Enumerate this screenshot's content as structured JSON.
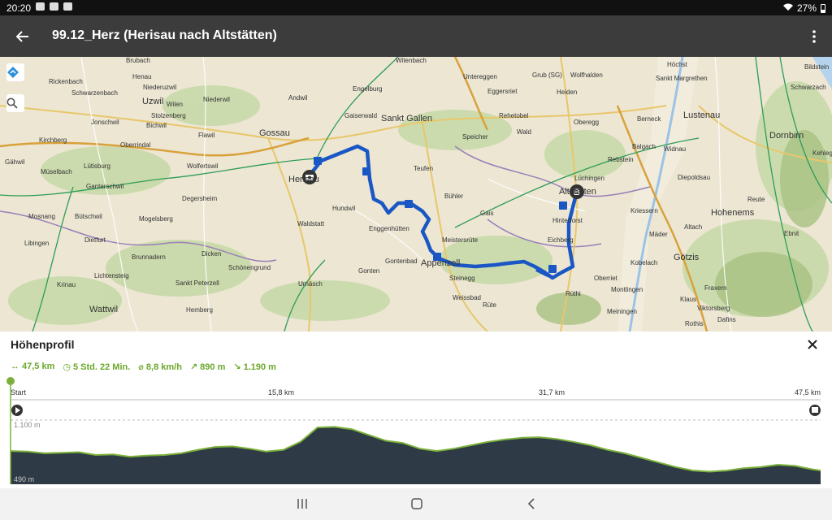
{
  "status_bar": {
    "time": "20:20",
    "battery": "27%"
  },
  "app_bar": {
    "title": "99.12_Herz (Herisau nach Altstätten)",
    "back_icon": "arrow-left-icon",
    "menu_icon": "more-vert-icon"
  },
  "map": {
    "labels": [
      "Brubach",
      "Rickenbach",
      "Schwarzenbach",
      "Uzwil",
      "Henau",
      "Niederuzwil",
      "Wilen",
      "Stolzenberg",
      "Jonschwil",
      "Bichwil",
      "Niederwil",
      "Flawil",
      "Kirchberg",
      "Oberrindal",
      "Gähwil",
      "Lütisburg",
      "Müselbach",
      "Wolfertswil",
      "Ganterschwil",
      "Degersheim",
      "Mosnang",
      "Bütschwil",
      "Mogelsberg",
      "Dietfurt",
      "Brunnadern",
      "Dicken",
      "Libingen",
      "Schönengrund",
      "Krinau",
      "Lichtensteig",
      "Sankt Peterzell",
      "Urnäsch",
      "Hemberg",
      "Wattwil",
      "Gossau",
      "Andwil",
      "Witenbach",
      "Engelburg",
      "Gaiserwald",
      "Sankt Gallen",
      "Teufen",
      "Herisau",
      "Waldstatt",
      "Hundwil",
      "Enggenhütten",
      "Bühler",
      "Speicher",
      "Gais",
      "Meistersrüte",
      "Gontenbad",
      "Gonten",
      "Appenzell",
      "Steinegg",
      "Weissbad",
      "Rüte",
      "Untereggen",
      "Eggersriet",
      "Rehetobel",
      "Wald",
      "Grub (SG)",
      "Wolfhalden",
      "Heiden",
      "Oberegg",
      "Berneck",
      "Balgach",
      "Rebstein",
      "Widnau",
      "Lüchingen",
      "Altstätten",
      "Hinterforst",
      "Eichberg",
      "Kriessern",
      "Diepoldsau",
      "Oberriet",
      "Kobelach",
      "Montlingen",
      "Meiningen",
      "Rüthi",
      "Höchst",
      "Sankt Margrethen",
      "Lustenau",
      "Dornbirn",
      "Bildstein",
      "Schwarzach",
      "Kehlegg",
      "Reute",
      "Hohenems",
      "Altach",
      "Mäder",
      "Götzis",
      "Ebnit",
      "Fraxern",
      "Klaus",
      "Viktorsberg",
      "Rothis",
      "Dafins"
    ],
    "route_icon": "route-icon",
    "search_icon": "search-icon",
    "start_marker_icon": "camera-marker-icon",
    "end_marker": "B"
  },
  "profile": {
    "title": "Höhenprofil",
    "close_icon": "close-icon",
    "stats": {
      "distance": "47,5 km",
      "duration": "5 Std. 22 Min.",
      "speed": "8,8 km/h",
      "ascent": "890 m",
      "descent": "1.190 m"
    },
    "stat_icons": [
      "distance-icon",
      "clock-icon",
      "speed-icon",
      "ascent-icon",
      "descent-icon"
    ],
    "axis_labels": [
      "Start",
      "15,8 km",
      "31,7 km",
      "47,5 km"
    ],
    "start_icon": "play-icon",
    "finish_icon": "finish-flag-icon",
    "y_top_label": "1.100 m",
    "y_bottom_label": "490 m"
  },
  "chart_data": {
    "type": "area",
    "title": "Höhenprofil",
    "xlabel": "",
    "ylabel": "",
    "x_unit": "km",
    "y_unit": "m",
    "xlim": [
      0,
      47.5
    ],
    "ylim": [
      490,
      1100
    ],
    "x_ticks": [
      "Start",
      "15,8 km",
      "31,7 km",
      "47,5 km"
    ],
    "y_ticks": [
      "1.100 m",
      "490 m"
    ],
    "x": [
      0,
      1,
      2,
      3,
      4,
      5,
      6,
      7,
      8,
      9,
      10,
      11,
      12,
      13,
      14,
      15,
      16,
      17,
      18,
      19,
      20,
      21,
      22,
      23,
      24,
      25,
      26,
      27,
      28,
      29,
      30,
      31,
      32,
      33,
      34,
      35,
      36,
      37,
      38,
      39,
      40,
      41,
      42,
      43,
      44,
      45,
      46,
      47,
      47.5
    ],
    "values": [
      780,
      775,
      760,
      765,
      770,
      745,
      750,
      730,
      740,
      745,
      760,
      790,
      815,
      820,
      800,
      775,
      790,
      860,
      985,
      990,
      970,
      920,
      870,
      850,
      800,
      780,
      800,
      830,
      860,
      880,
      895,
      900,
      885,
      860,
      830,
      790,
      760,
      720,
      680,
      640,
      610,
      600,
      610,
      630,
      640,
      660,
      650,
      620,
      610
    ],
    "colors": {
      "fill": "#2e3a45",
      "line": "#7bb13a"
    }
  },
  "nav_bar": {
    "recents_icon": "recents-icon",
    "home_icon": "home-icon",
    "back_icon": "back-chevron-icon"
  }
}
